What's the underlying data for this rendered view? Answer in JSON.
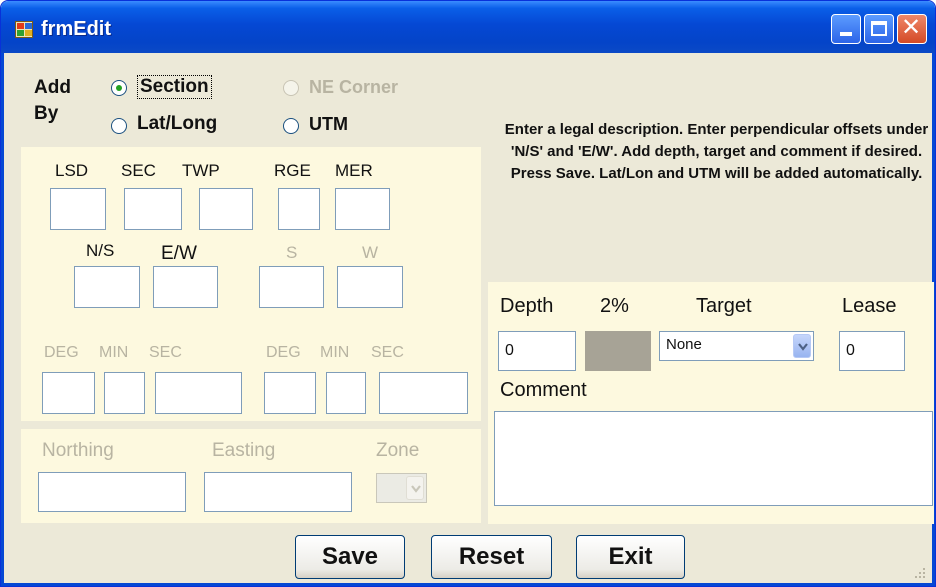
{
  "window": {
    "title": "frmEdit"
  },
  "add_by": {
    "label_line1": "Add",
    "label_line2": "By",
    "options": [
      {
        "label": "Section",
        "checked": true,
        "enabled": true
      },
      {
        "label": "NE Corner",
        "checked": false,
        "enabled": false
      },
      {
        "label": "Lat/Long",
        "checked": false,
        "enabled": true
      },
      {
        "label": "UTM",
        "checked": false,
        "enabled": true
      }
    ]
  },
  "legal": {
    "labels": {
      "lsd": "LSD",
      "sec": "SEC",
      "twp": "TWP",
      "rge": "RGE",
      "mer": "MER"
    },
    "offset_labels": {
      "ns": "N/S",
      "ew": "E/W",
      "s": "S",
      "w": "W"
    }
  },
  "latlong": {
    "lat_labels": {
      "deg": "DEG",
      "min": "MIN",
      "sec": "SEC"
    },
    "lon_labels": {
      "deg": "DEG",
      "min": "MIN",
      "sec": "SEC"
    }
  },
  "utm": {
    "northing": "Northing",
    "easting": "Easting",
    "zone": "Zone"
  },
  "instructions": "Enter a legal description. Enter perpendicular offsets under 'N/S' and 'E/W'. Add depth, target and comment if desired. Press Save. Lat/Lon and UTM will be added automatically.",
  "well": {
    "depth_label": "Depth",
    "depth_value": "0",
    "percent_label": "2%",
    "target_label": "Target",
    "target_value": "None",
    "lease_label": "Lease",
    "lease_value": "0",
    "comment_label": "Comment",
    "comment_value": ""
  },
  "buttons": {
    "save": "Save",
    "reset": "Reset",
    "exit": "Exit"
  },
  "colors": {
    "titlebar": "#0548d4",
    "panel": "#fdf9df",
    "form_bg": "#ece9d8",
    "radio_dot": "#21a121",
    "swatch": "#a7a396"
  }
}
